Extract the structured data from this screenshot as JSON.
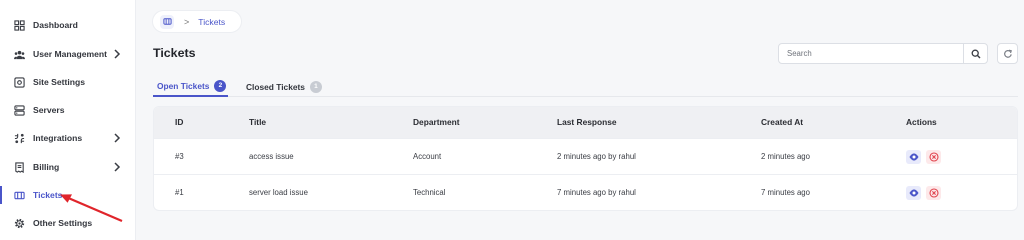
{
  "sidebar": {
    "items": [
      {
        "label": "Dashboard",
        "icon": "grid-icon"
      },
      {
        "label": "User Management",
        "icon": "users-icon",
        "has_children": true
      },
      {
        "label": "Site Settings",
        "icon": "settings-square-icon"
      },
      {
        "label": "Servers",
        "icon": "server-icon"
      },
      {
        "label": "Integrations",
        "icon": "integration-icon",
        "has_children": true
      },
      {
        "label": "Billing",
        "icon": "receipt-icon",
        "has_children": true
      },
      {
        "label": "Tickets",
        "icon": "ticket-icon",
        "active": true
      },
      {
        "label": "Other Settings",
        "icon": "gear-icon"
      }
    ]
  },
  "breadcrumb": {
    "current": "Tickets"
  },
  "page": {
    "title": "Tickets"
  },
  "search": {
    "placeholder": "Search"
  },
  "tabs": [
    {
      "label": "Open Tickets",
      "count": "2",
      "active": true
    },
    {
      "label": "Closed Tickets",
      "count": "1",
      "active": false
    }
  ],
  "table": {
    "headers": [
      "ID",
      "Title",
      "Department",
      "Last Response",
      "Created At",
      "Actions"
    ],
    "rows": [
      {
        "id": "#3",
        "title": "access issue",
        "department": "Account",
        "last_response": "2 minutes ago by rahul",
        "created_at": "2 minutes ago"
      },
      {
        "id": "#1",
        "title": "server load issue",
        "department": "Technical",
        "last_response": "7 minutes ago by rahul",
        "created_at": "7 minutes ago"
      }
    ]
  },
  "colors": {
    "accent": "#4a55c9",
    "danger": "#e0434d",
    "annotation_arrow": "#e0252b"
  }
}
